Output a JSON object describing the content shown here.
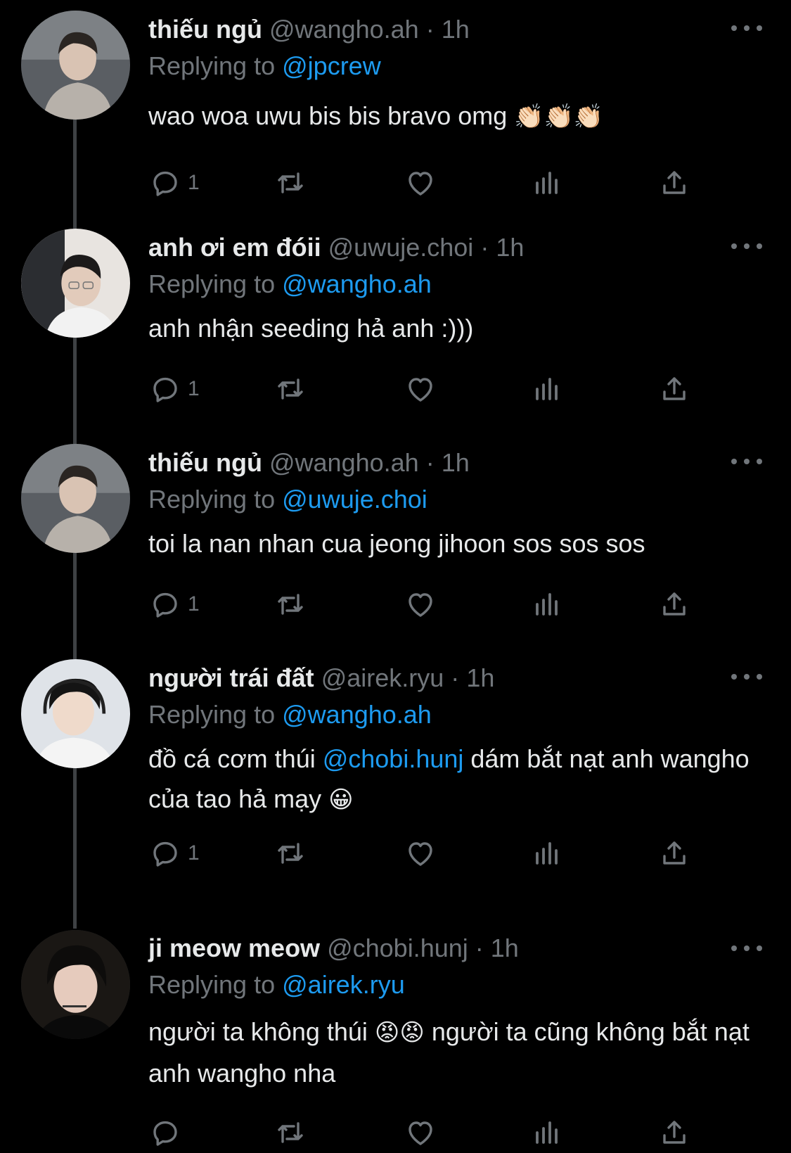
{
  "colors": {
    "background": "#000000",
    "text_primary": "#e7e9ea",
    "text_secondary": "#71767b",
    "accent": "#1d9bf0",
    "thread_line": "#3e4144"
  },
  "icons": {
    "reply": "speech-bubble-icon",
    "retweet": "retweet-arrows-icon",
    "like": "heart-icon",
    "views": "bar-chart-icon",
    "share": "upload-arrow-icon",
    "more": "three-dots-icon"
  },
  "replying_to_label": "Replying to",
  "tweets": [
    {
      "name": "thiếu ngủ",
      "handle": "@wangho.ah",
      "separator": "·",
      "time": "1h",
      "replying_to": "@jpcrew",
      "text_parts": [
        "wao woa uwu bis bis bravo omg ",
        "👏🏻👏🏻👏🏻"
      ],
      "reply_count": "1"
    },
    {
      "name": "anh ơi em đóii",
      "handle": "@uwuje.choi",
      "separator": "·",
      "time": "1h",
      "replying_to": "@wangho.ah",
      "text_parts": [
        "anh nhận seeding hả anh :)))"
      ],
      "reply_count": "1"
    },
    {
      "name": "thiếu ngủ",
      "handle": "@wangho.ah",
      "separator": "·",
      "time": "1h",
      "replying_to": "@uwuje.choi",
      "text_parts": [
        "toi la nan nhan cua jeong jihoon sos sos sos"
      ],
      "reply_count": "1"
    },
    {
      "name": "người trái đất",
      "handle": "@airek.ryu",
      "separator": "·",
      "time": "1h",
      "replying_to": "@wangho.ah",
      "text_parts": [
        "đồ cá cơm thúi ",
        "@chobi.hunj",
        " dám bắt nạt anh wangho của tao hả mạy ",
        "😀"
      ],
      "reply_count": "1"
    },
    {
      "name": "ji meow meow",
      "handle": "@chobi.hunj",
      "separator": "·",
      "time": "1h",
      "replying_to": "@airek.ryu",
      "text_parts": [
        "người ta không thúi ",
        "😡😡",
        "  người ta cũng không bắt nạt anh wangho nha"
      ],
      "reply_count": ""
    }
  ]
}
